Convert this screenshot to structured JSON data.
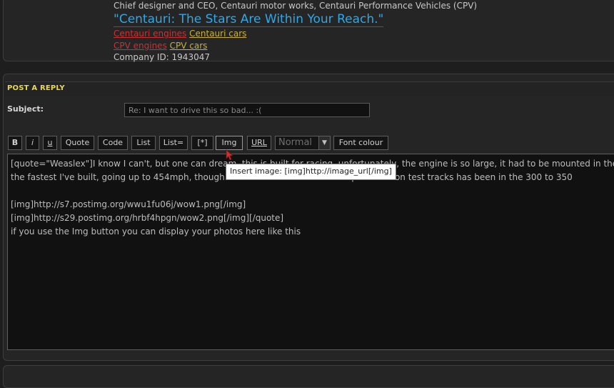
{
  "signature": {
    "line1": "Chief designer and CEO, Centauri motor works, Centauri Performance Vehicles (CPV)",
    "quote": "\"Centauri: The Stars Are Within Your Reach.\"",
    "links_row1": [
      {
        "label": "Centauri engines",
        "color": "#c83232"
      },
      {
        "label": "Centauri cars",
        "color": "#c9b03a"
      }
    ],
    "links_row2": [
      {
        "label": "CPV engines",
        "color": "#c83232"
      },
      {
        "label": "CPV cars",
        "color": "#c9b03a"
      }
    ],
    "company_id": "Company ID: 1943047"
  },
  "reply": {
    "title": "POST A REPLY",
    "subject_label": "Subject:",
    "subject_value": "Re: I want to drive this so bad... :(",
    "toolbar": {
      "bold": "B",
      "italic": "i",
      "underline": "u",
      "quote": "Quote",
      "code": "Code",
      "list": "List",
      "list_eq": "List=",
      "list_item": "[*]",
      "img": "Img",
      "url": "URL",
      "font_size_selected": "Normal",
      "font_colour": "Font colour"
    },
    "message": "[quote=\"Weaslex\"]I know I can't, but one can dream, this is built for racing, unfortunately, the engine is so large, it had to be mounted in the rear\nthe fastest I've built, going up to 454mph, though o                                          speed I hit on test tracks has been in the 300 to 350\n\n[img]http://s7.postimg.org/wwu1fu06j/wow1.png[/img]\n[img]http://s29.postimg.org/hrbf4hpgn/wow2.png[/img][/quote]\nif you use the Img button you can display your photos here like this",
    "tooltip": "Insert image: [img]http://image_url[/img]"
  },
  "colors": {
    "background": "#1e1e1e",
    "panel": "#252525",
    "accent_title": "#e8d94a",
    "signature_quote": "#2da8e8"
  }
}
